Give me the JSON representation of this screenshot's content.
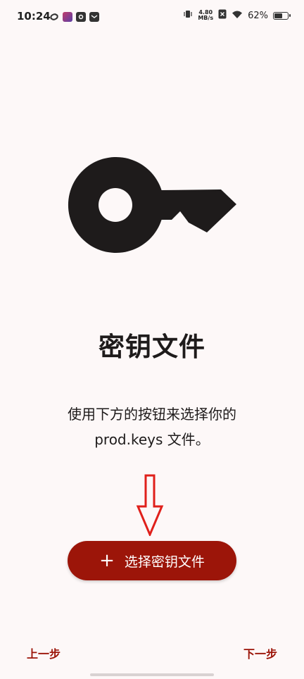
{
  "status_bar": {
    "time": "10:24",
    "net_speed_value": "4.80",
    "net_speed_unit": "MB/s",
    "battery_level": "62%",
    "battery_fraction": 0.62
  },
  "main": {
    "title": "密钥文件",
    "description": "使用下方的按钮来选择你的 prod.keys 文件。",
    "select_button_icon": "+",
    "select_button_label": "选择密钥文件"
  },
  "nav": {
    "prev_label": "上一步",
    "next_label": "下一步"
  },
  "icons": {
    "key": "key-icon",
    "arrow": "arrow-down-icon",
    "plus": "plus-icon"
  },
  "colors": {
    "accent": "#9c1509",
    "arrow": "#e0201b",
    "background": "#fdf8f8",
    "text": "#1e1b1b"
  }
}
